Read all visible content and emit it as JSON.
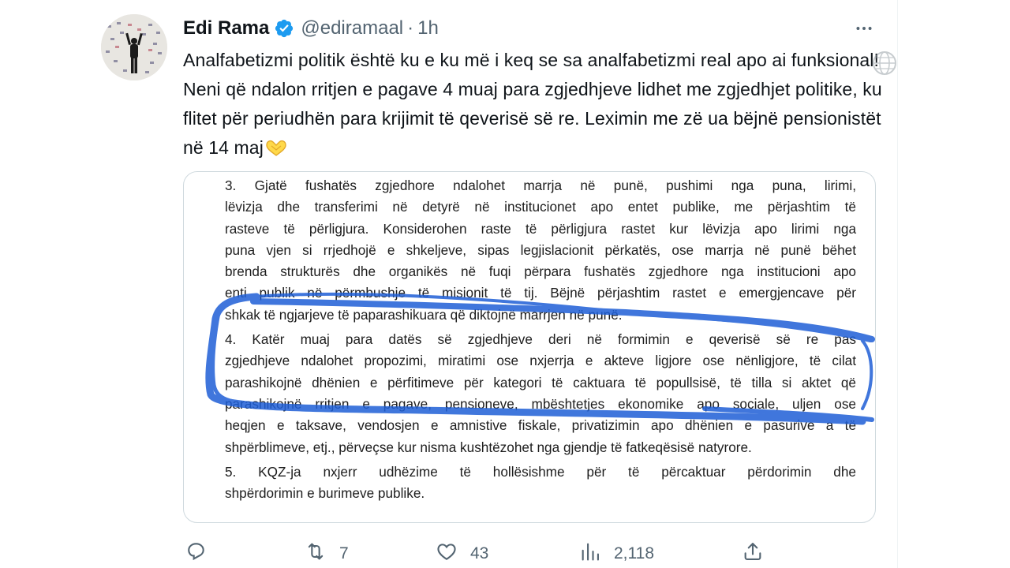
{
  "author": {
    "name": "Edi Rama",
    "handle": "@ediramaal",
    "separator": "·",
    "time": "1h"
  },
  "icons": {
    "verified": "verified-badge-icon",
    "more": "more-horizontal-icon",
    "reply": "reply-icon",
    "retweet": "retweet-icon",
    "like": "like-icon",
    "views": "views-icon",
    "share": "share-icon"
  },
  "colors": {
    "verified": "#1d9bf0",
    "muted": "#536471",
    "scribble": "#1f5fd6"
  },
  "tweet": {
    "text": "Analfabetizmi politik është ku e ku më i keq se sa analfabetizmi real apo ai funksional! Neni që ndalon rritjen e pagave 4 muaj para zgjedhjeve lidhet me zgjedhjet politike, ku flitet për periudhën para krijimit të qeverisë së re. Leximin me zë ua bëjnë pensionistët në 14 maj"
  },
  "document": {
    "lines": [
      "3. Gjatë fushatës zgjedhore ndalohet marrja në punë, pushimi nga puna, lirimi,",
      "lëvizja dhe transferimi në detyrë në institucionet apo entet publike, me përjashtim të",
      "rasteve të përligjura. Konsiderohen raste të përligjura rastet kur lëvizja apo lirimi nga",
      "puna vjen si rrjedhojë e shkeljeve, sipas legjislacionit përkatës, ose marrja në punë bëhet",
      "brenda strukturës dhe organikës në fuqi përpara fushatës zgjedhore nga institucioni apo",
      "enti publik në përmbushje të misionit të tij. Bëjnë përjashtim rastet e emergjencave për",
      "shkak të ngjarjeve të paparashikuara që diktojnë marrjen në punë.",
      "4. Katër muaj para datës së zgjedhjeve deri në formimin e qeverisë së re pas",
      "zgjedhjeve ndalohet propozimi, miratimi ose nxjerrja e akteve ligjore ose nënligjore, të cilat",
      "parashikojnë dhënien e përfitimeve për kategori të caktuara të popullsisë, të tilla si aktet që",
      "parashikojnë rritjen e pagave, pensioneve, mbështetjes ekonomike apo sociale, uljen ose",
      "heqjen e taksave, vendosjen e amnistive fiskale, privatizimin apo dhënien e pasurive a të",
      "shpërblimeve, etj., përveçse kur nisma kushtëzohet nga gjendje të fatkeqësisë natyrore.",
      "5. KQZ-ja nxjerr udhëzime të hollësishme për të përcaktuar përdorimin dhe",
      "shpërdorimin e burimeve publike."
    ]
  },
  "actions": {
    "reply_count": "",
    "retweet_count": "7",
    "like_count": "43",
    "views_count": "2,118"
  }
}
